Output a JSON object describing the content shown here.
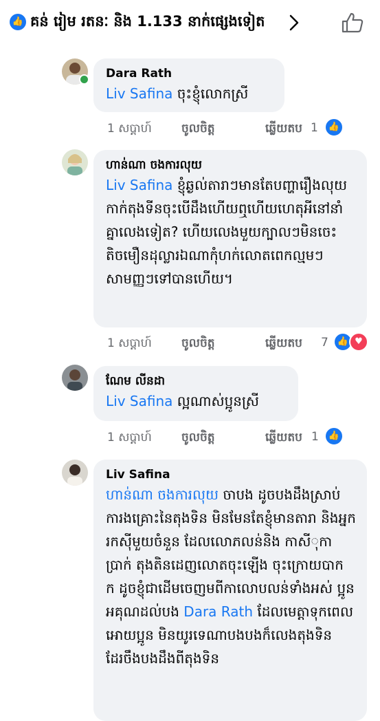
{
  "reactions_bar": {
    "summary": "គន់ រៀម រតនៈ និង 1.133 នាក់ផ្សេងទៀត",
    "like_glyph": "👍",
    "chevron_icon": "chevron-right-icon",
    "thumb_icon": "thumbs-up-outline-icon"
  },
  "actions": {
    "like": "ចូលចិត្ត",
    "reply": "ឆ្លើយតប"
  },
  "comments": [
    {
      "author": "Dara Rath",
      "mention": "Liv Safina",
      "text": " ចុះខ្ញុំលោកស្រី",
      "time": "1 សប្តាហ៍",
      "reaction_count": "1",
      "online": true
    },
    {
      "author": "ហាន់ណា ចងការលុយ",
      "mention": "Liv Safina",
      "text": " ខ្ញុំឆ្ងល់តារាៗមានតែបញ្ហារឿងលុយកាក់តុងទីនចុះបើដឹងហើយឮហើយហេតុអីនៅនាំគ្នាលេងទៀត?  ហើយលេងមួយក្បាលៗមិនចេះតិចមឿនដុល្លារឯណាកុំហក់លោតពេកល្មមៗសាមញ្ញៗទៅបានហើយ។",
      "time": "1 សប្តាហ៍",
      "reaction_count": "7"
    },
    {
      "author": "ណែម លីនដា",
      "mention": "Liv Safina",
      "text": " ល្អណាស់ប្អូនស្រី",
      "time": "1 សប្តាហ៍",
      "reaction_count": "1"
    },
    {
      "author": "Liv Safina",
      "mention": "ហាន់ណា ចងការលុយ",
      "text_part1": " ចាបង ដូចបងដឹងស្រាប់ ការងគ្រោះនៃតុងទិន មិនមែនតែខ្ញុំមានតារា និងអ្នករកស៊ីមួយចំនួន ដែលលោភលន់និង កាសីុកាប្រាក់ តុងតិនដេញលោតចុះឡើង  ចុះក្រោយបាក ក ដូចខ្ញុំជាដើមចេញមពីកាលោបលន់ទាំងអស់ ប្អូនអគុណដល់បង ",
      "mention2": "Dara Rath",
      "text_part2": " ដែលមេត្តាទុកពេលអោយប្អូន មិនយូរទេណាបងបងក៏លេងតុងទិនដែរចឹងបងដឹងពីតុងទិន"
    }
  ]
}
